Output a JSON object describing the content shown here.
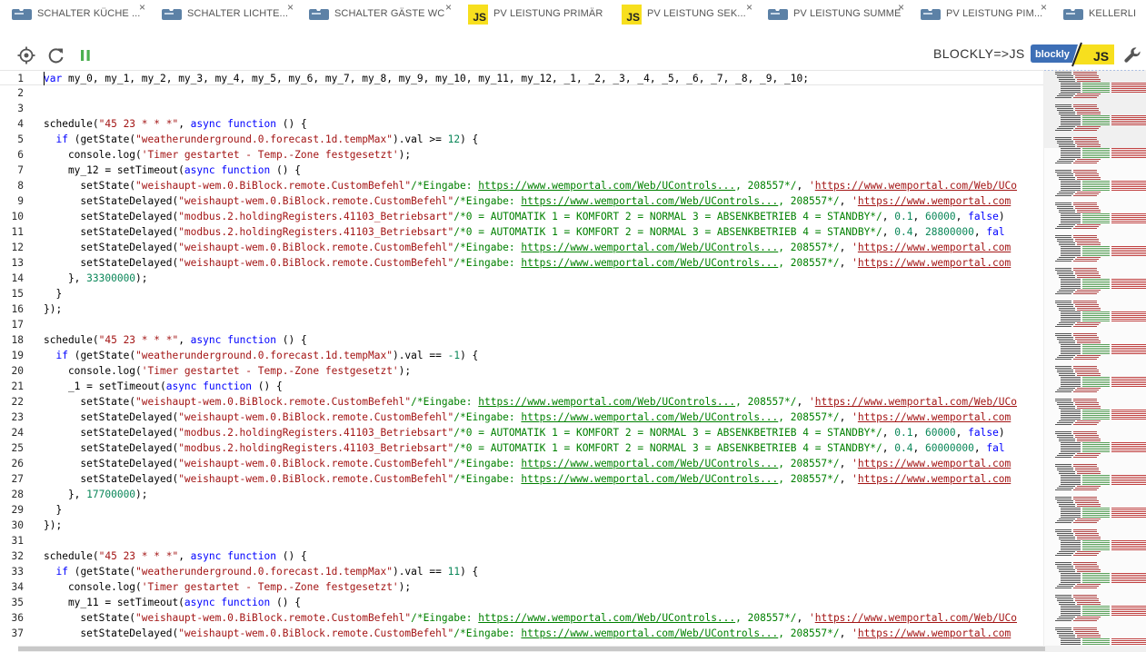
{
  "tabs": [
    {
      "label": "SCHALTER KÜCHE ...",
      "icon": "blockly-icon",
      "closable": true
    },
    {
      "label": "SCHALTER LICHTE...",
      "icon": "blockly-icon",
      "closable": true
    },
    {
      "label": "SCHALTER GÄSTE WC",
      "icon": "blockly-icon",
      "closable": true
    },
    {
      "label": "PV LEISTUNG PRIMÄR",
      "icon": "js-icon",
      "closable": false
    },
    {
      "label": "PV LEISTUNG SEK...",
      "icon": "js-icon",
      "closable": true
    },
    {
      "label": "PV LEISTUNG SUMME",
      "icon": "blockly-icon",
      "closable": true
    },
    {
      "label": "PV LEISTUNG PIM...",
      "icon": "blockly-icon",
      "closable": true
    },
    {
      "label": "KELLERLI",
      "icon": "blockly-icon",
      "closable": false
    }
  ],
  "toolbar": {
    "convert_label": "BLOCKLY=>JS",
    "logo_left": "blockly",
    "logo_right": "JS",
    "icons": [
      "target-icon",
      "reload-icon",
      "pause-icon",
      "wrench-icon"
    ]
  },
  "colors": {
    "keyword": "#0000ff",
    "string": "#a31515",
    "number": "#098658",
    "comment": "#008000",
    "pause": "#4caf50"
  },
  "code_lines": [
    {
      "n": "1",
      "html": "<span class=\"k\">var</span> my_0, my_1, my_2, my_3, my_4, my_5, my_6, my_7, my_8, my_9, my_10, my_11, my_12, _1, _2, _3, _4, _5, _6, _7, _8, _9, _10;"
    },
    {
      "n": "2",
      "html": ""
    },
    {
      "n": "3",
      "html": ""
    },
    {
      "n": "4",
      "html": "schedule(<span class=\"s\">\"45 23 * * *\"</span>, <span class=\"k\">async</span> <span class=\"k\">function</span> () {"
    },
    {
      "n": "5",
      "html": "  <span class=\"k\">if</span> (getState(<span class=\"s\">\"weatherunderground.0.forecast.1d.tempMax\"</span>).val &gt;= <span class=\"n\">12</span>) {"
    },
    {
      "n": "6",
      "html": "    console.log(<span class=\"s\">'Timer gestartet - Temp.-Zone festgesetzt'</span>);"
    },
    {
      "n": "7",
      "html": "    my_12 = setTimeout(<span class=\"k\">async</span> <span class=\"k\">function</span> () {"
    },
    {
      "n": "8",
      "html": "      setState(<span class=\"s\">\"weishaupt-wem.0.BiBlock.remote.CustomBefehl\"</span><span class=\"c\">/*Eingabe: <span class=\"u\">https://www.wemportal.com/Web/UControls...</span>, 208557*/</span>, <span class=\"s\">'<span class=\"u\">https://www.wemportal.com/Web/UCo</span></span>"
    },
    {
      "n": "9",
      "html": "      setStateDelayed(<span class=\"s\">\"weishaupt-wem.0.BiBlock.remote.CustomBefehl\"</span><span class=\"c\">/*Eingabe: <span class=\"u\">https://www.wemportal.com/Web/UControls...</span>, 208557*/</span>, <span class=\"s\">'<span class=\"u\">https://www.wemportal.com</span></span>"
    },
    {
      "n": "10",
      "html": "      setStateDelayed(<span class=\"s\">\"modbus.2.holdingRegisters.41103_Betriebsart\"</span><span class=\"c\">/*0 = AUTOMATIK 1 = KOMFORT 2 = NORMAL 3 = ABSENKBETRIEB 4 = STANDBY*/</span>, <span class=\"n\">0.1</span>, <span class=\"n\">60000</span>, <span class=\"k\">false</span>)"
    },
    {
      "n": "11",
      "html": "      setStateDelayed(<span class=\"s\">\"modbus.2.holdingRegisters.41103_Betriebsart\"</span><span class=\"c\">/*0 = AUTOMATIK 1 = KOMFORT 2 = NORMAL 3 = ABSENKBETRIEB 4 = STANDBY*/</span>, <span class=\"n\">0.4</span>, <span class=\"n\">28800000</span>, <span class=\"k\">fal</span>"
    },
    {
      "n": "12",
      "html": "      setStateDelayed(<span class=\"s\">\"weishaupt-wem.0.BiBlock.remote.CustomBefehl\"</span><span class=\"c\">/*Eingabe: <span class=\"u\">https://www.wemportal.com/Web/UControls...</span>, 208557*/</span>, <span class=\"s\">'<span class=\"u\">https://www.wemportal.com</span></span>"
    },
    {
      "n": "13",
      "html": "      setStateDelayed(<span class=\"s\">\"weishaupt-wem.0.BiBlock.remote.CustomBefehl\"</span><span class=\"c\">/*Eingabe: <span class=\"u\">https://www.wemportal.com/Web/UControls...</span>, 208557*/</span>, <span class=\"s\">'<span class=\"u\">https://www.wemportal.com</span></span>"
    },
    {
      "n": "14",
      "html": "    }, <span class=\"n\">33300000</span>);"
    },
    {
      "n": "15",
      "html": "  }"
    },
    {
      "n": "16",
      "html": "});"
    },
    {
      "n": "17",
      "html": ""
    },
    {
      "n": "18",
      "html": "schedule(<span class=\"s\">\"45 23 * * *\"</span>, <span class=\"k\">async</span> <span class=\"k\">function</span> () {"
    },
    {
      "n": "19",
      "html": "  <span class=\"k\">if</span> (getState(<span class=\"s\">\"weatherunderground.0.forecast.1d.tempMax\"</span>).val == <span class=\"n\">-1</span>) {"
    },
    {
      "n": "20",
      "html": "    console.log(<span class=\"s\">'Timer gestartet - Temp.-Zone festgesetzt'</span>);"
    },
    {
      "n": "21",
      "html": "    _1 = setTimeout(<span class=\"k\">async</span> <span class=\"k\">function</span> () {"
    },
    {
      "n": "22",
      "html": "      setState(<span class=\"s\">\"weishaupt-wem.0.BiBlock.remote.CustomBefehl\"</span><span class=\"c\">/*Eingabe: <span class=\"u\">https://www.wemportal.com/Web/UControls...</span>, 208557*/</span>, <span class=\"s\">'<span class=\"u\">https://www.wemportal.com/Web/UCo</span></span>"
    },
    {
      "n": "23",
      "html": "      setStateDelayed(<span class=\"s\">\"weishaupt-wem.0.BiBlock.remote.CustomBefehl\"</span><span class=\"c\">/*Eingabe: <span class=\"u\">https://www.wemportal.com/Web/UControls...</span>, 208557*/</span>, <span class=\"s\">'<span class=\"u\">https://www.wemportal.com</span></span>"
    },
    {
      "n": "24",
      "html": "      setStateDelayed(<span class=\"s\">\"modbus.2.holdingRegisters.41103_Betriebsart\"</span><span class=\"c\">/*0 = AUTOMATIK 1 = KOMFORT 2 = NORMAL 3 = ABSENKBETRIEB 4 = STANDBY*/</span>, <span class=\"n\">0.1</span>, <span class=\"n\">60000</span>, <span class=\"k\">false</span>)"
    },
    {
      "n": "25",
      "html": "      setStateDelayed(<span class=\"s\">\"modbus.2.holdingRegisters.41103_Betriebsart\"</span><span class=\"c\">/*0 = AUTOMATIK 1 = KOMFORT 2 = NORMAL 3 = ABSENKBETRIEB 4 = STANDBY*/</span>, <span class=\"n\">0.4</span>, <span class=\"n\">60000000</span>, <span class=\"k\">fal</span>"
    },
    {
      "n": "26",
      "html": "      setStateDelayed(<span class=\"s\">\"weishaupt-wem.0.BiBlock.remote.CustomBefehl\"</span><span class=\"c\">/*Eingabe: <span class=\"u\">https://www.wemportal.com/Web/UControls...</span>, 208557*/</span>, <span class=\"s\">'<span class=\"u\">https://www.wemportal.com</span></span>"
    },
    {
      "n": "27",
      "html": "      setStateDelayed(<span class=\"s\">\"weishaupt-wem.0.BiBlock.remote.CustomBefehl\"</span><span class=\"c\">/*Eingabe: <span class=\"u\">https://www.wemportal.com/Web/UControls...</span>, 208557*/</span>, <span class=\"s\">'<span class=\"u\">https://www.wemportal.com</span></span>"
    },
    {
      "n": "28",
      "html": "    }, <span class=\"n\">17700000</span>);"
    },
    {
      "n": "29",
      "html": "  }"
    },
    {
      "n": "30",
      "html": "});"
    },
    {
      "n": "31",
      "html": ""
    },
    {
      "n": "32",
      "html": "schedule(<span class=\"s\">\"45 23 * * *\"</span>, <span class=\"k\">async</span> <span class=\"k\">function</span> () {"
    },
    {
      "n": "33",
      "html": "  <span class=\"k\">if</span> (getState(<span class=\"s\">\"weatherunderground.0.forecast.1d.tempMax\"</span>).val == <span class=\"n\">11</span>) {"
    },
    {
      "n": "34",
      "html": "    console.log(<span class=\"s\">'Timer gestartet - Temp.-Zone festgesetzt'</span>);"
    },
    {
      "n": "35",
      "html": "    my_11 = setTimeout(<span class=\"k\">async</span> <span class=\"k\">function</span> () {"
    },
    {
      "n": "36",
      "html": "      setState(<span class=\"s\">\"weishaupt-wem.0.BiBlock.remote.CustomBefehl\"</span><span class=\"c\">/*Eingabe: <span class=\"u\">https://www.wemportal.com/Web/UControls...</span>, 208557*/</span>, <span class=\"s\">'<span class=\"u\">https://www.wemportal.com/Web/UCo</span></span>"
    },
    {
      "n": "37",
      "html": "      setStateDelayed(<span class=\"s\">\"weishaupt-wem.0.BiBlock.remote.CustomBefehl\"</span><span class=\"c\">/*Eingabe: <span class=\"u\">https://www.wemportal.com/Web/UControls...</span>, 208557*/</span>, <span class=\"s\">'<span class=\"u\">https://www.wemportal.com</span></span>"
    }
  ]
}
